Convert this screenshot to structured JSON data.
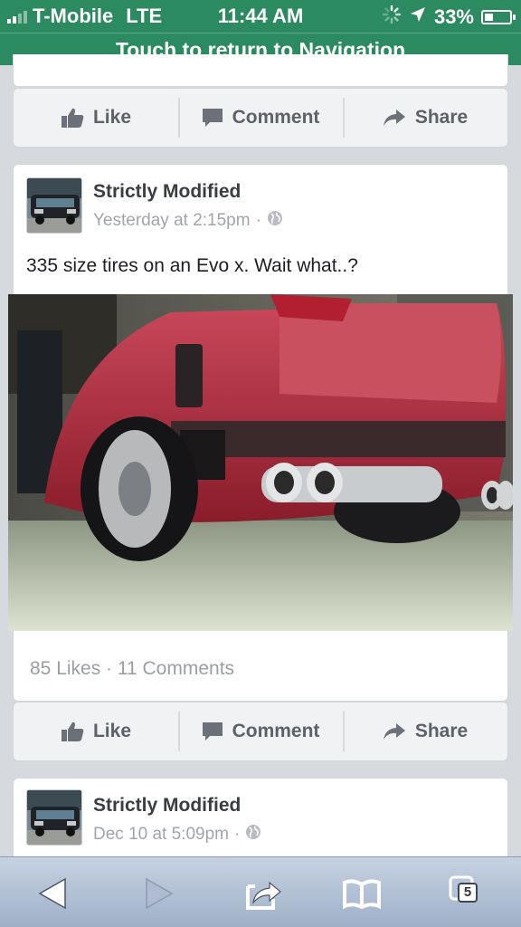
{
  "status_bar": {
    "carrier": "T-Mobile",
    "network": "LTE",
    "time": "11:44 AM",
    "battery_percent": "33%",
    "battery_level": 0.33,
    "signal_bars": 4,
    "signal_bars_filled": 2
  },
  "nav_bar": {
    "label": "Touch to return to Navigation"
  },
  "actions": {
    "like": "Like",
    "comment": "Comment",
    "share": "Share"
  },
  "posts": [
    {
      "author": "Strictly Modified",
      "timestamp": "Yesterday at 2:15pm",
      "separator": "·",
      "text": "335 size tires on an Evo x. Wait what..?",
      "stats": "85 Likes · 11 Comments"
    },
    {
      "author": "Strictly Modified",
      "timestamp": "Dec 10 at 5:09pm",
      "separator": "·"
    }
  ],
  "toolbar": {
    "tabs_count": "5"
  },
  "colors": {
    "header_green": "#2b8a5f",
    "page_bg": "#d6d9de",
    "action_text": "#5d6168",
    "meta_text": "#a0a4ab"
  },
  "icons": [
    "signal-bars-icon",
    "activity-spinner-icon",
    "location-arrow-icon",
    "battery-icon",
    "like-icon",
    "comment-icon",
    "share-icon",
    "globe-icon",
    "back-icon",
    "forward-icon",
    "share-sheet-icon",
    "bookmarks-icon",
    "tabs-icon"
  ]
}
